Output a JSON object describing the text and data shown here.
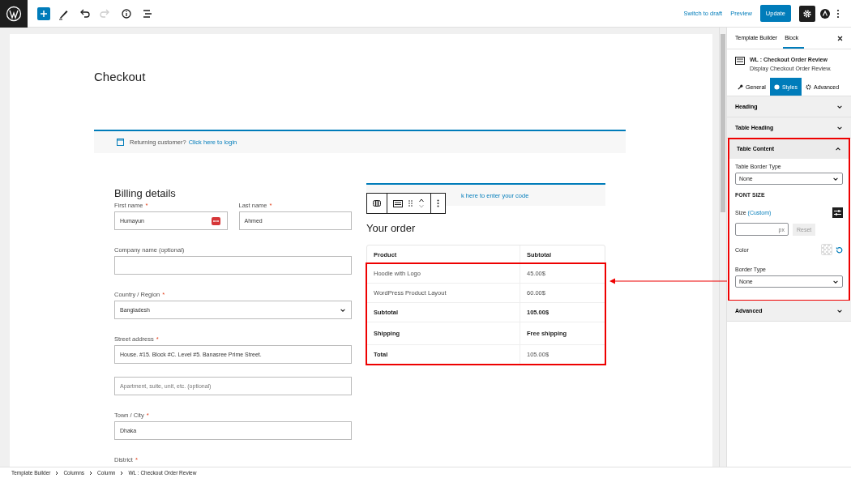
{
  "topbar": {
    "tools": [
      {
        "kind": "add",
        "disabled": false
      },
      {
        "kind": "pencil",
        "disabled": false
      },
      {
        "kind": "undo",
        "disabled": false
      },
      {
        "kind": "redo",
        "disabled": true
      },
      {
        "kind": "info",
        "disabled": false
      },
      {
        "kind": "list",
        "disabled": false
      }
    ],
    "switch_to_draft": "Switch to draft",
    "preview": "Preview",
    "update": "Update",
    "settings_pressed": true
  },
  "page": {
    "title": "Checkout",
    "login_notice": {
      "text": "Returning customer?",
      "link": "Click here to login"
    },
    "billing": {
      "heading": "Billing details",
      "rows": [
        [
          {
            "kind": "text",
            "label": "First name",
            "required_mark": "*",
            "value": "Humayun",
            "autofill_badge": true
          },
          {
            "kind": "text",
            "label": "Last name",
            "required_mark": "*",
            "value": "Ahmed"
          }
        ],
        [
          {
            "kind": "text",
            "label": "Company name (optional)"
          }
        ],
        [
          {
            "kind": "select",
            "label": "Country / Region",
            "required_mark": "*",
            "value": "Bangladesh"
          }
        ],
        [
          {
            "kind": "text",
            "label": "Street address",
            "required_mark": "*",
            "value": "House. #15. Block #C. Level #5. Banasree Prime Street."
          }
        ],
        [
          {
            "kind": "text",
            "placeholder": "Apartment, suite, unit, etc. (optional)"
          }
        ],
        [
          {
            "kind": "text",
            "label": "Town / City",
            "required_mark": "*",
            "value": "Dhaka"
          }
        ],
        [
          {
            "kind": "label",
            "label": "District",
            "required_mark": "*"
          }
        ]
      ]
    },
    "coupon_notice": {
      "link": "k here to enter your code"
    },
    "order": {
      "heading": "Your order",
      "columns": [
        "Product",
        "Subtotal"
      ],
      "highlighted": true,
      "rows": [
        {
          "kind": "item",
          "label": "Hoodie with Logo",
          "value": "45.00$"
        },
        {
          "kind": "item",
          "label": "WordPress Product Layout",
          "value": "60.00$"
        },
        {
          "kind": "subtotal",
          "label": "Subtotal",
          "value": "105.00$"
        },
        {
          "kind": "shipping",
          "label": "Shipping",
          "value": "Free shipping"
        },
        {
          "kind": "total",
          "label": "Total",
          "value": "105.00$"
        }
      ]
    }
  },
  "sidebar": {
    "tabs": [
      {
        "label": "Template Builder",
        "selected": false
      },
      {
        "label": "Block",
        "selected": true
      }
    ],
    "block": {
      "title": "WL : Checkout Order Review",
      "description": "Display Checkout Order Review."
    },
    "style_tabs": [
      {
        "kind": "wrench",
        "label": "General",
        "selected": false
      },
      {
        "kind": "drop",
        "label": "Styles",
        "selected": true
      },
      {
        "kind": "gear",
        "label": "Advanced",
        "selected": false
      }
    ],
    "panels": [
      {
        "title": "Heading",
        "expanded": false,
        "highlighted": false
      },
      {
        "title": "Table Heading",
        "expanded": false,
        "highlighted": false
      },
      {
        "title": "Table Content",
        "expanded": true,
        "highlighted": true,
        "controls": [
          {
            "kind": "select",
            "label": "Table Border Type",
            "value": "None"
          },
          {
            "kind": "heading",
            "label": "FONT SIZE"
          },
          {
            "kind": "size",
            "label": "Size",
            "note": "(Custom)",
            "unit": "px",
            "reset": "Reset"
          },
          {
            "kind": "color",
            "label": "Color"
          },
          {
            "kind": "select",
            "label": "Border Type",
            "value": "None"
          }
        ]
      },
      {
        "title": "Advanced",
        "expanded": false,
        "highlighted": false
      }
    ]
  },
  "breadcrumbs": [
    "Template Builder",
    "Columns",
    "Column",
    "WL : Checkout Order Review"
  ]
}
